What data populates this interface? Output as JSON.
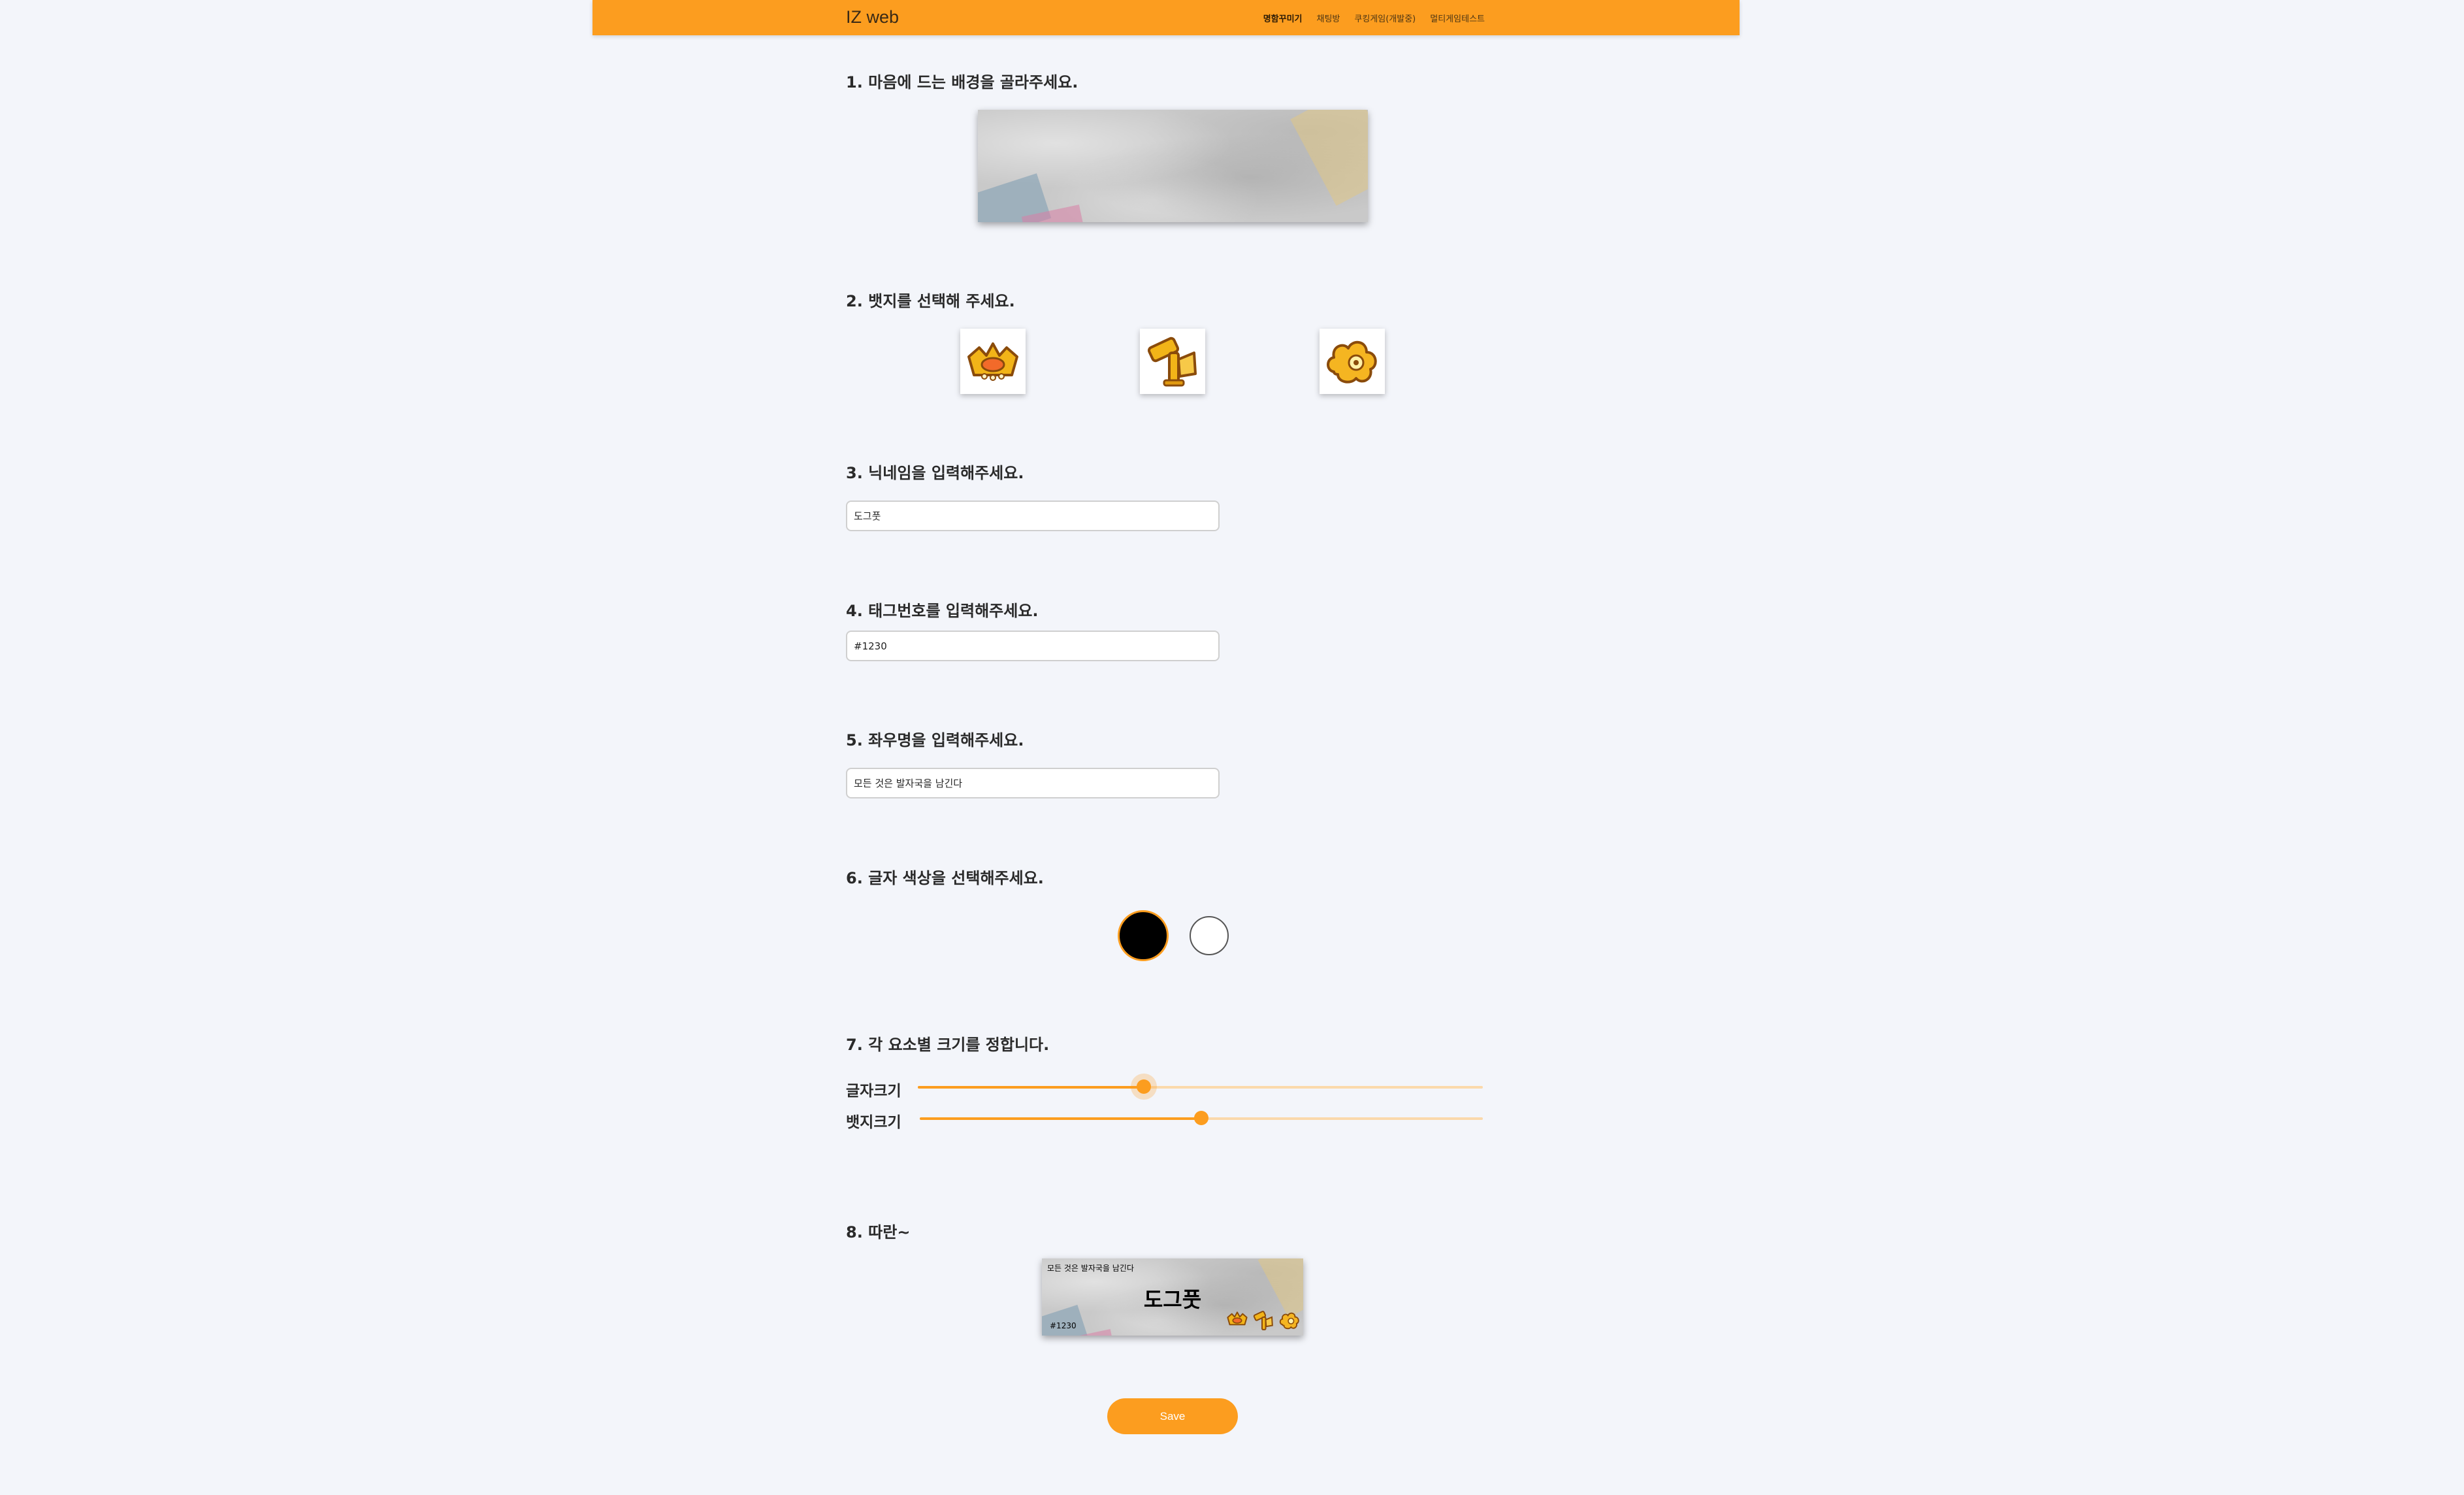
{
  "navbar": {
    "brand": "IZ web",
    "links": [
      "명함꾸미기",
      "채팅방",
      "쿠킹게임(개발중)",
      "멀티게임테스트"
    ],
    "active_index": 0,
    "accent_color": "#fc9d1f"
  },
  "steps": {
    "background": {
      "title": "1. 마음에 드는 배경을 골라주세요."
    },
    "badges": {
      "title": "2. 뱃지를 선택해 주세요.",
      "items": [
        "crown-badge-icon",
        "hammer-badge-icon",
        "cloud-badge-icon"
      ]
    },
    "nickname": {
      "title": "3. 닉네임을 입력해주세요.",
      "value": "도그풋"
    },
    "tag": {
      "title": "4. 태그번호를 입력해주세요.",
      "value": "#1230"
    },
    "motto": {
      "title": "5. 좌우명을 입력해주세요.",
      "value": "모든 것은 발자국을 남긴다"
    },
    "text_color": {
      "title": "6. 글자 색상을 선택해주세요.",
      "options": [
        "#000000",
        "#ffffff"
      ],
      "selected_index": 0,
      "selected_ring": "#fc9d1f"
    },
    "sizes": {
      "title": "7. 각 요소별 크기를 정합니다.",
      "font_size": {
        "label": "글자크기",
        "fraction": 0.4
      },
      "badge_size": {
        "label": "뱃지크기",
        "fraction": 0.5
      }
    },
    "preview": {
      "title": "8. 따란~",
      "motto": "모든 것은 발자국을 남긴다",
      "nickname": "도그풋",
      "tag": "#1230"
    }
  },
  "save_label": "Save"
}
